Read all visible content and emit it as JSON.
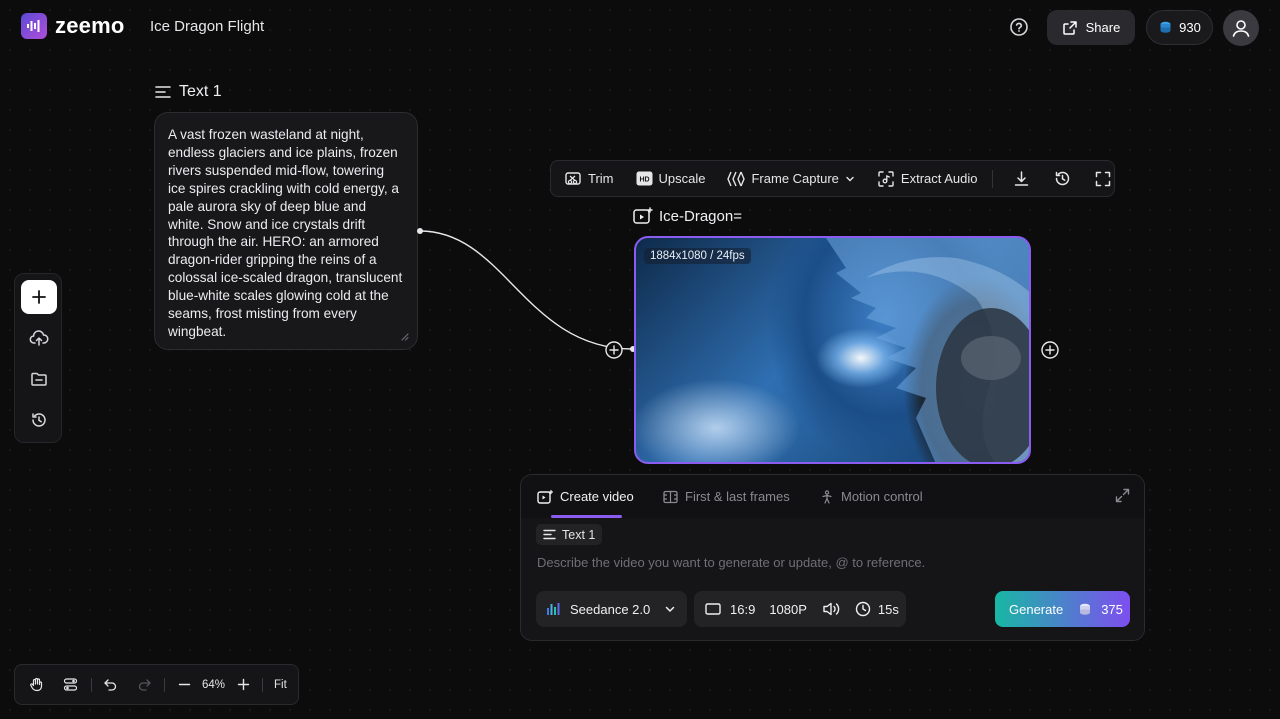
{
  "app": {
    "name": "zeemo",
    "project_title": "Ice Dragon Flight"
  },
  "header": {
    "share_label": "Share",
    "credits": "930"
  },
  "text_node": {
    "title": "Text 1",
    "content": "A vast frozen wasteland at night, endless glaciers and ice plains, frozen rivers suspended mid-flow, towering ice spires crackling with cold energy, a pale aurora sky of deep blue and white. Snow and ice crystals drift through the air. HERO: an armored dragon-rider gripping the reins of a colossal ice-scaled dragon, translucent blue-white scales glowing cold at the seams, frost misting from every wingbeat."
  },
  "video_toolbar": {
    "trim": "Trim",
    "upscale": "Upscale",
    "frame_capture": "Frame Capture",
    "extract_audio": "Extract Audio"
  },
  "video_node": {
    "title": "Ice-Dragon=",
    "badge": "1884x1080 / 24fps"
  },
  "gen_panel": {
    "tabs": [
      "Create video",
      "First & last frames",
      "Motion control"
    ],
    "ref_chip": "Text 1",
    "placeholder": "Describe the video you want to generate or update, @ to reference.",
    "model": "Seedance 2.0",
    "aspect": "16:9",
    "resolution": "1080P",
    "duration": "15s",
    "generate_label": "Generate",
    "generate_cost": "375"
  },
  "bottom_toolbar": {
    "zoom": "64%",
    "fit_label": "Fit"
  },
  "colors": {
    "accent": "#8a5cf0",
    "background": "#0c0c0d",
    "panel": "#151517"
  }
}
